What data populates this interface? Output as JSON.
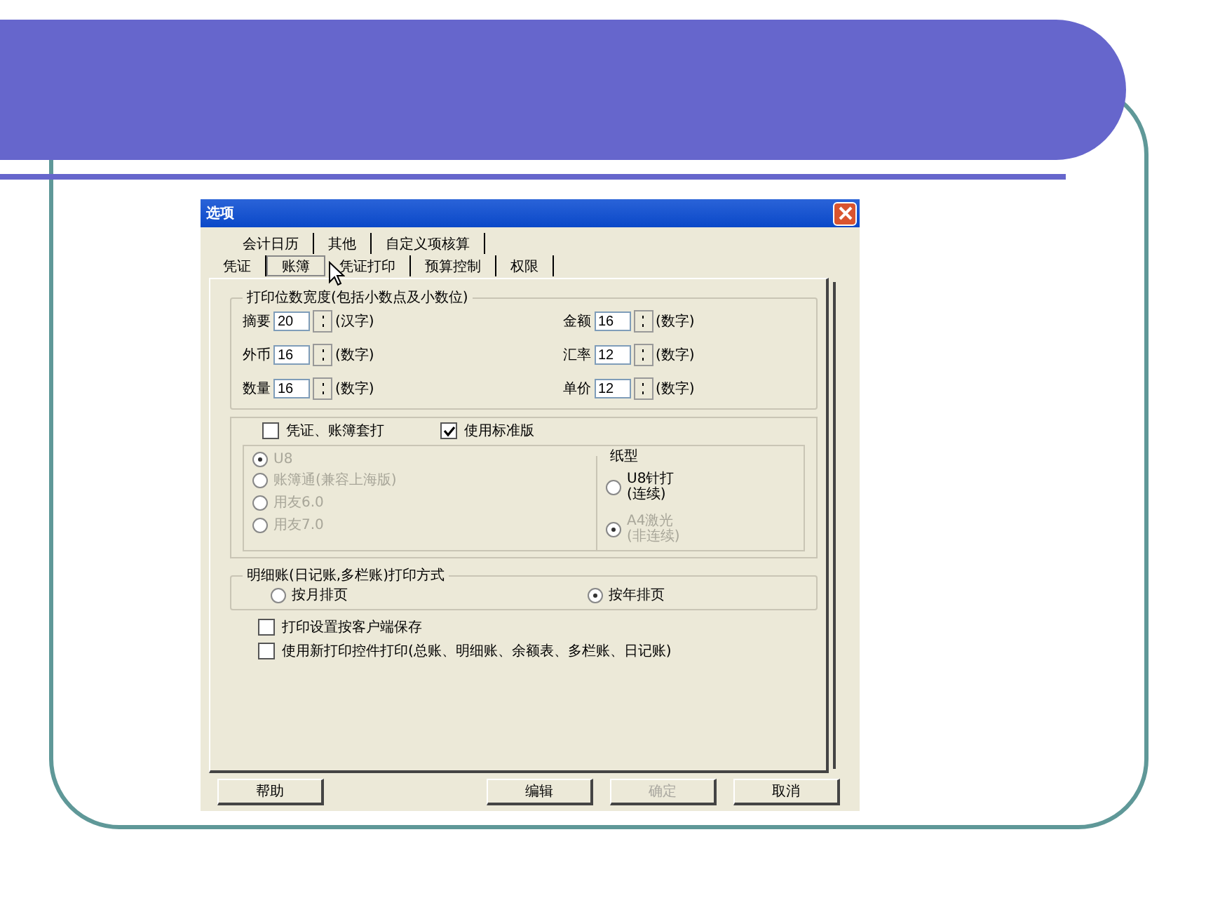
{
  "dialog": {
    "title": "选项",
    "tab_rows": [
      [
        {
          "label": "会计日历",
          "selected": false
        },
        {
          "label": "其他",
          "selected": false
        },
        {
          "label": "自定义项核算",
          "selected": false
        }
      ],
      [
        {
          "label": "凭证",
          "selected": false
        },
        {
          "label": "账簿",
          "selected": true
        },
        {
          "label": "凭证打印",
          "selected": false
        },
        {
          "label": "预算控制",
          "selected": false
        },
        {
          "label": "权限",
          "selected": false
        }
      ]
    ],
    "print_width": {
      "legend": "打印位数宽度(包括小数点及小数位)",
      "fields": [
        {
          "label": "摘要",
          "value": "20",
          "unit": "(汉字)"
        },
        {
          "label": "金额",
          "value": "16",
          "unit": "(数字)"
        },
        {
          "label": "外币",
          "value": "16",
          "unit": "(数字)"
        },
        {
          "label": "汇率",
          "value": "12",
          "unit": "(数字)"
        },
        {
          "label": "数量",
          "value": "16",
          "unit": "(数字)"
        },
        {
          "label": "单价",
          "value": "12",
          "unit": "(数字)"
        }
      ]
    },
    "print_set": {
      "checks": [
        {
          "label": "凭证、账簿套打",
          "checked": false
        },
        {
          "label": "使用标准版",
          "checked": true
        }
      ],
      "versions": [
        {
          "label": "U8",
          "selected": true,
          "disabled": true
        },
        {
          "label": "账簿通(兼容上海版)",
          "selected": false,
          "disabled": true
        },
        {
          "label": "用友6.0",
          "selected": false,
          "disabled": true
        },
        {
          "label": "用友7.0",
          "selected": false,
          "disabled": true
        }
      ],
      "paper": {
        "legend": "纸型",
        "options": [
          {
            "lines": [
              "U8针打",
              "(连续)"
            ],
            "selected": false,
            "disabled": false
          },
          {
            "lines": [
              "A4激光",
              "(非连续)"
            ],
            "selected": true,
            "disabled": true
          }
        ]
      }
    },
    "detail_mode": {
      "legend": "明细账(日记账,多栏账)打印方式",
      "options": [
        {
          "label": "按月排页",
          "selected": false
        },
        {
          "label": "按年排页",
          "selected": true
        }
      ]
    },
    "options": [
      {
        "label": "打印设置按客户端保存",
        "checked": false
      },
      {
        "label": "使用新打印控件打印(总账、明细账、余额表、多栏账、日记账)",
        "checked": false
      }
    ],
    "buttons": [
      {
        "label": "帮助",
        "disabled": false
      },
      {
        "label": "编辑",
        "disabled": false
      },
      {
        "label": "确定",
        "disabled": true
      },
      {
        "label": "取消",
        "disabled": false
      }
    ]
  }
}
